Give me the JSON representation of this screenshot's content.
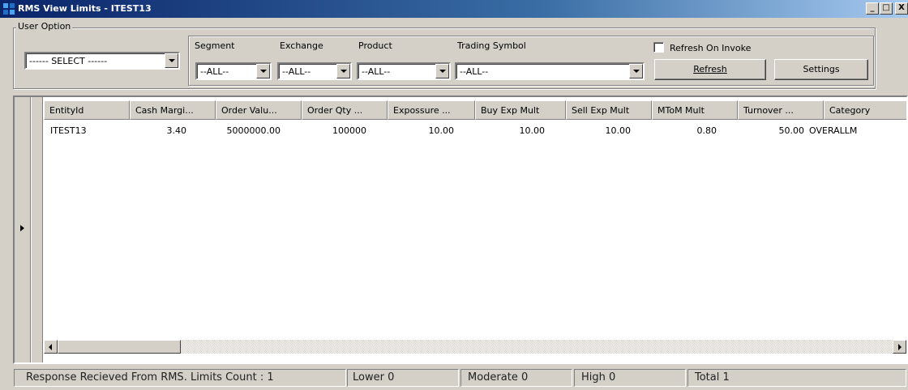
{
  "window": {
    "title": "RMS View Limits - ITEST13",
    "controls": {
      "minimize": "_",
      "maximize": "□",
      "close": "X"
    }
  },
  "filters": {
    "user_option_label": "User Option",
    "user_option_value": "------ SELECT ------",
    "segment_label": "Segment",
    "segment_value": "--ALL--",
    "exchange_label": "Exchange",
    "exchange_value": "--ALL--",
    "product_label": "Product",
    "product_value": "--ALL--",
    "symbol_label": "Trading Symbol",
    "symbol_value": "--ALL--",
    "refresh_on_invoke_label": "Refresh On Invoke",
    "refresh_on_invoke_checked": false,
    "refresh_button": "Refresh",
    "settings_button": "Settings"
  },
  "grid": {
    "columns": [
      "EntityId",
      "Cash Margi...",
      "Order Valu...",
      "Order Qty ...",
      "Expossure ...",
      "Buy Exp Mult",
      "Sell Exp Mult",
      "MToM Mult",
      "Turnover ...",
      "Category"
    ],
    "rows": [
      [
        "ITEST13",
        "3.40",
        "5000000.00",
        "100000",
        "10.00",
        "10.00",
        "10.00",
        "0.80",
        "50.00",
        "OVERALLM"
      ]
    ]
  },
  "status": {
    "message": "Response Recieved From RMS. Limits Count : 1",
    "lower": "Lower 0",
    "moderate": "Moderate 0",
    "high": "High 0",
    "total": "Total 1"
  }
}
